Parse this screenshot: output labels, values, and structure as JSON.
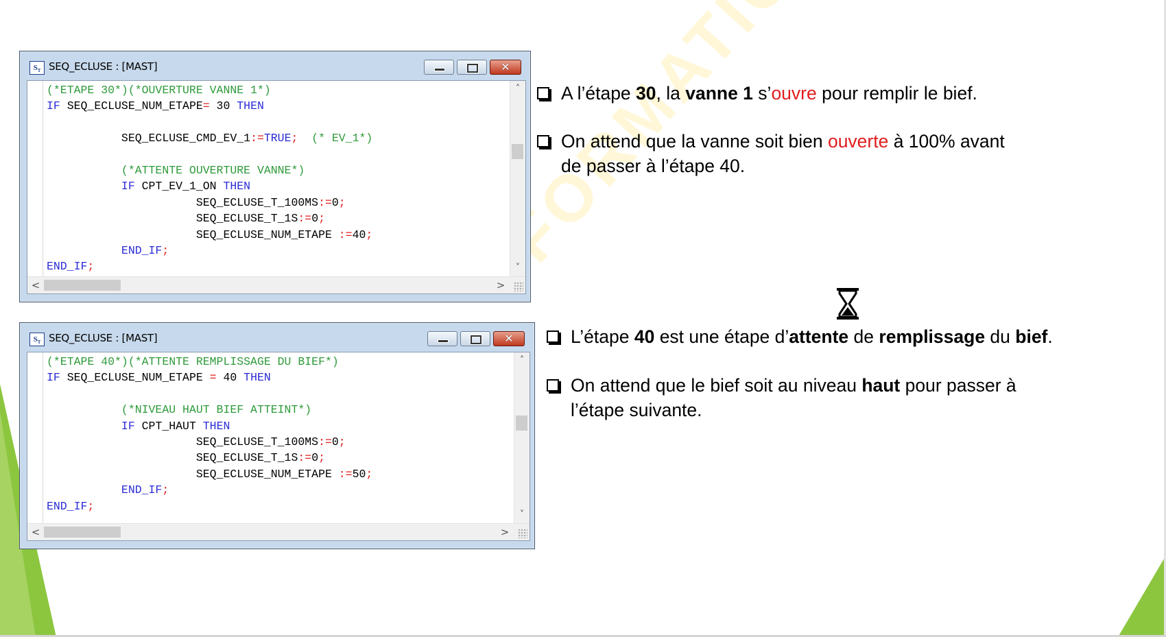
{
  "windows": [
    {
      "title": "SEQ_ECLUSE : [MAST]",
      "icon": "st-language-icon",
      "code_lines": [
        [
          {
            "t": "c",
            "v": "(*ETAPE 30*)(*OUVERTURE VANNE 1*)"
          }
        ],
        [
          {
            "t": "k",
            "v": "IF"
          },
          {
            "t": "",
            "v": " SEQ_ECLUSE_NUM_ETAPE"
          },
          {
            "t": "o",
            "v": "="
          },
          {
            "t": "",
            "v": " 30 "
          },
          {
            "t": "k",
            "v": "THEN"
          }
        ],
        [
          {
            "t": "",
            "v": ""
          }
        ],
        [
          {
            "t": "",
            "v": "           SEQ_ECLUSE_CMD_EV_1"
          },
          {
            "t": "o",
            "v": ":="
          },
          {
            "t": "k",
            "v": "TRUE"
          },
          {
            "t": "o",
            "v": ";"
          },
          {
            "t": "c",
            "v": "  (* EV_1*)"
          }
        ],
        [
          {
            "t": "",
            "v": ""
          }
        ],
        [
          {
            "t": "c",
            "v": "           (*ATTENTE OUVERTURE VANNE*)"
          }
        ],
        [
          {
            "t": "",
            "v": "           "
          },
          {
            "t": "k",
            "v": "IF"
          },
          {
            "t": "",
            "v": " CPT_EV_1_ON "
          },
          {
            "t": "k",
            "v": "THEN"
          }
        ],
        [
          {
            "t": "",
            "v": "                      SEQ_ECLUSE_T_100MS"
          },
          {
            "t": "o",
            "v": ":="
          },
          {
            "t": "",
            "v": "0"
          },
          {
            "t": "o",
            "v": ";"
          }
        ],
        [
          {
            "t": "",
            "v": "                      SEQ_ECLUSE_T_1S"
          },
          {
            "t": "o",
            "v": ":="
          },
          {
            "t": "",
            "v": "0"
          },
          {
            "t": "o",
            "v": ";"
          }
        ],
        [
          {
            "t": "",
            "v": "                      SEQ_ECLUSE_NUM_ETAPE "
          },
          {
            "t": "o",
            "v": ":="
          },
          {
            "t": "",
            "v": "40"
          },
          {
            "t": "o",
            "v": ";"
          }
        ],
        [
          {
            "t": "",
            "v": "           "
          },
          {
            "t": "k",
            "v": "END_IF"
          },
          {
            "t": "o",
            "v": ";"
          }
        ],
        [
          {
            "t": "k",
            "v": "END_IF"
          },
          {
            "t": "o",
            "v": ";"
          }
        ]
      ]
    },
    {
      "title": "SEQ_ECLUSE : [MAST]",
      "icon": "st-language-icon",
      "code_lines": [
        [
          {
            "t": "c",
            "v": "(*ETAPE 40*)(*ATTENTE REMPLISSAGE DU BIEF*)"
          }
        ],
        [
          {
            "t": "k",
            "v": "IF"
          },
          {
            "t": "",
            "v": " SEQ_ECLUSE_NUM_ETAPE "
          },
          {
            "t": "o",
            "v": "="
          },
          {
            "t": "",
            "v": " 40 "
          },
          {
            "t": "k",
            "v": "THEN"
          }
        ],
        [
          {
            "t": "",
            "v": ""
          }
        ],
        [
          {
            "t": "c",
            "v": "           (*NIVEAU HAUT BIEF ATTEINT*)"
          }
        ],
        [
          {
            "t": "",
            "v": "           "
          },
          {
            "t": "k",
            "v": "IF"
          },
          {
            "t": "",
            "v": " CPT_HAUT "
          },
          {
            "t": "k",
            "v": "THEN"
          }
        ],
        [
          {
            "t": "",
            "v": "                      SEQ_ECLUSE_T_100MS"
          },
          {
            "t": "o",
            "v": ":="
          },
          {
            "t": "",
            "v": "0"
          },
          {
            "t": "o",
            "v": ";"
          }
        ],
        [
          {
            "t": "",
            "v": "                      SEQ_ECLUSE_T_1S"
          },
          {
            "t": "o",
            "v": ":="
          },
          {
            "t": "",
            "v": "0"
          },
          {
            "t": "o",
            "v": ";"
          }
        ],
        [
          {
            "t": "",
            "v": "                      SEQ_ECLUSE_NUM_ETAPE "
          },
          {
            "t": "o",
            "v": ":="
          },
          {
            "t": "",
            "v": "50"
          },
          {
            "t": "o",
            "v": ";"
          }
        ],
        [
          {
            "t": "",
            "v": "           "
          },
          {
            "t": "k",
            "v": "END_IF"
          },
          {
            "t": "o",
            "v": ";"
          }
        ],
        [
          {
            "t": "k",
            "v": "END_IF"
          },
          {
            "t": "o",
            "v": ";"
          }
        ]
      ]
    }
  ],
  "controls": {
    "minimize": "minimize-icon",
    "maximize": "maximize-icon",
    "close": "close-icon"
  },
  "scroll": {
    "up": "˄",
    "down": "˅",
    "left": "<",
    "right": ">"
  },
  "watermark": "FORMATION OUEST",
  "bullets": [
    {
      "lines": [
        [
          {
            "t": "",
            "v": "A l’étape "
          },
          {
            "t": "b",
            "v": "30"
          },
          {
            "t": "",
            "v": ", la "
          },
          {
            "t": "b",
            "v": "vanne 1"
          },
          {
            "t": "",
            "v": " s’"
          },
          {
            "t": "r",
            "v": "ouvre"
          },
          {
            "t": "",
            "v": " pour remplir le bief."
          }
        ]
      ]
    },
    {
      "lines": [
        [
          {
            "t": "",
            "v": "On attend que la vanne soit bien "
          },
          {
            "t": "r",
            "v": "ouverte"
          },
          {
            "t": "",
            "v": " à 100% avant"
          }
        ],
        [
          {
            "t": "",
            "v": "de passer à l’étape 40."
          }
        ]
      ]
    },
    {
      "lines": [
        [
          {
            "t": "",
            "v": "L’étape "
          },
          {
            "t": "b",
            "v": "40"
          },
          {
            "t": "",
            "v": " est une étape d’"
          },
          {
            "t": "b",
            "v": "attente"
          },
          {
            "t": "",
            "v": " de "
          },
          {
            "t": "b",
            "v": "remplissage"
          },
          {
            "t": "",
            "v": " du "
          },
          {
            "t": "b",
            "v": "bief"
          },
          {
            "t": "",
            "v": "."
          }
        ]
      ]
    },
    {
      "lines": [
        [
          {
            "t": "",
            "v": "On attend que le bief soit au niveau "
          },
          {
            "t": "b",
            "v": "haut"
          },
          {
            "t": "",
            "v": " pour passer à"
          }
        ],
        [
          {
            "t": "",
            "v": "l’étape suivante."
          }
        ]
      ]
    }
  ],
  "colors": {
    "comment": "#2e9a3a",
    "keyword": "#2b2bd6",
    "operator": "#e01e1e",
    "accent_green": "#8cc63f",
    "highlight_red": "#e01e1e"
  },
  "hourglass_icon": "hourglass-icon"
}
